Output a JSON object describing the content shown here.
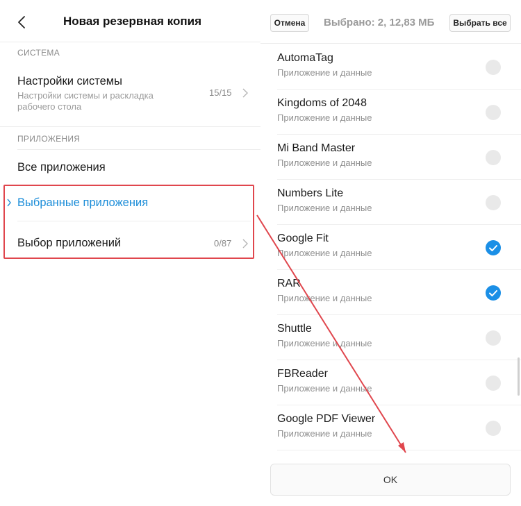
{
  "left": {
    "title": "Новая резервная копия",
    "sections": [
      {
        "label": "СИСТЕМА",
        "items": [
          {
            "title": "Настройки системы",
            "subtitle": "Настройки системы и раскладка рабочего стола",
            "count": "15/15"
          }
        ]
      },
      {
        "label": "ПРИЛОЖЕНИЯ",
        "items": [
          {
            "title": "Все приложения"
          },
          {
            "title": "Выбранные приложения",
            "active": true
          },
          {
            "title": "Выбор приложений",
            "count": "0/87"
          }
        ]
      }
    ]
  },
  "right": {
    "cancel_label": "Отмена",
    "selection_info": "Выбрано: 2, 12,83 МБ",
    "select_all_label": "Выбрать все",
    "apps": [
      {
        "name": "AutomaTag",
        "subtitle": "Приложение и данные",
        "checked": false
      },
      {
        "name": "Kingdoms of 2048",
        "subtitle": "Приложение и данные",
        "checked": false
      },
      {
        "name": "Mi Band Master",
        "subtitle": "Приложение и данные",
        "checked": false
      },
      {
        "name": "Numbers Lite",
        "subtitle": "Приложение и данные",
        "checked": false
      },
      {
        "name": "Google Fit",
        "subtitle": "Приложение и данные",
        "checked": true
      },
      {
        "name": "RAR",
        "subtitle": "Приложение и данные",
        "checked": true
      },
      {
        "name": "Shuttle",
        "subtitle": "Приложение и данные",
        "checked": false
      },
      {
        "name": "FBReader",
        "subtitle": "Приложение и данные",
        "checked": false
      },
      {
        "name": "Google PDF Viewer",
        "subtitle": "Приложение и данные",
        "checked": false
      }
    ],
    "ok_label": "OK"
  },
  "colors": {
    "accent": "#1a8cd8",
    "check_on": "#1b8fe6",
    "check_off": "#e9e9e9",
    "annotation_red": "#e0464d"
  },
  "icons": {
    "back": "chevron-left-icon",
    "row_chevron": "chevron-right-icon",
    "check": "checkmark-icon"
  }
}
